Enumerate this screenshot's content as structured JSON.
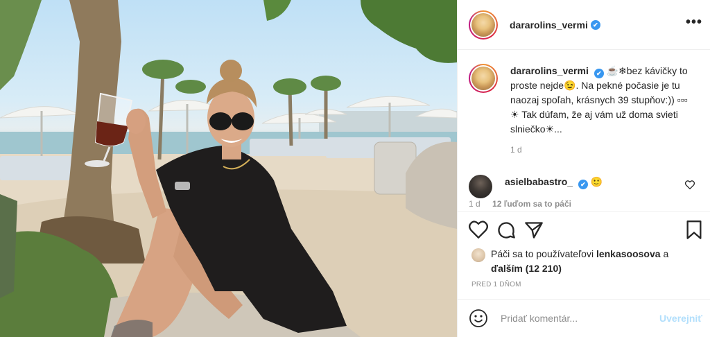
{
  "post": {
    "author": "dararolins_vermi",
    "verified_mark": "✔",
    "more_label": "•••",
    "caption": {
      "author": "dararolins_vermi",
      "text": "☕❄bez kávičky to proste nejde😉. Na pekné počasie je tu naozaj spoľah, krásnych 39 stupňov:)) ▫▫▫☀ Tak dúfam, že aj vám už doma svieti slniečko☀...",
      "time": "1 d"
    },
    "comment": {
      "author": "asielbabastro_",
      "text": "🙂",
      "time": "1 d",
      "likes": "12 ľuďom sa to páči"
    },
    "actions": {
      "icons": [
        "heart-icon",
        "comment-icon",
        "share-icon",
        "bookmark-icon"
      ]
    },
    "liked_by": {
      "prefix": "Páči sa to používateľovi",
      "user": "lenkasoosova",
      "joiner": "a",
      "others": "ďalším (12 210)"
    },
    "timeago": "PRED 1 DŇOM",
    "comment_box": {
      "placeholder": "Pridať komentár...",
      "post_label": "Uverejniť"
    },
    "colors": {
      "verified": "#3897f0",
      "post_button_disabled": "#b2dffc",
      "secondary_text": "#8e8e8e"
    }
  }
}
